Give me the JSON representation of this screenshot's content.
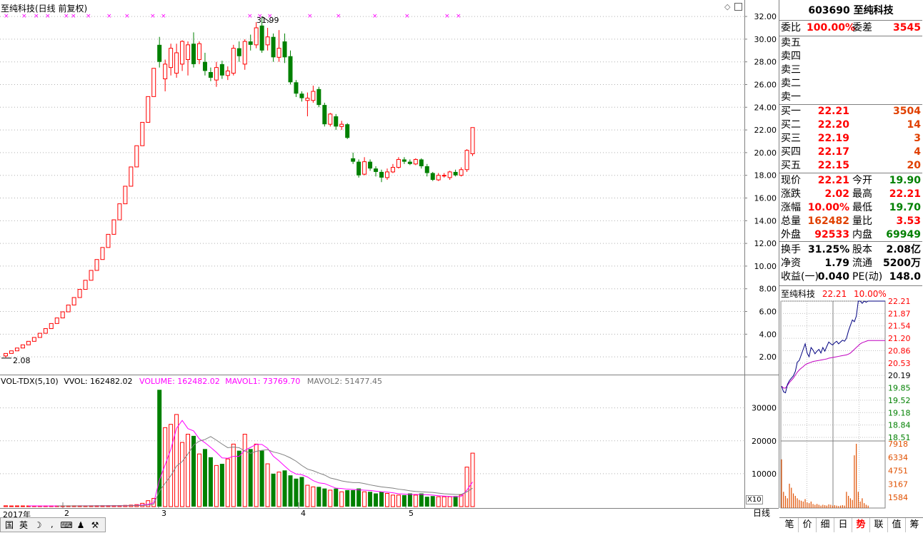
{
  "chart_header": {
    "title": "至纯科技(日线 前复权)",
    "max_label": "31.99",
    "min_label": "2.08",
    "diamond_icon": "diamond-icon",
    "square_icon": "square-icon"
  },
  "volume_header": {
    "name": "VOL-TDX(5,10)",
    "vvol": "VVOL: 162482.02",
    "volume": "VOLUME: 162482.02",
    "mavol1": "MAVOL1: 73769.70",
    "mavol2": "MAVOL2: 51477.45"
  },
  "x_axis": {
    "year": "2017年",
    "months": [
      "2",
      "3",
      "4",
      "5"
    ]
  },
  "price_axis": [
    "32.00",
    "30.00",
    "28.00",
    "26.00",
    "24.00",
    "22.00",
    "20.00",
    "18.00",
    "16.00",
    "14.00",
    "12.00",
    "10.00",
    "8.00",
    "6.00",
    "4.00",
    "2.00"
  ],
  "volume_axis": [
    "30000",
    "20000",
    "10000"
  ],
  "volume_unit": "X10",
  "period": "日线",
  "colors": {
    "up": "#ff0000",
    "down": "#008000",
    "ma1": "#ff00ff",
    "ma2": "#808080",
    "intraday_price": "#000080",
    "intraday_avg": "#c000c0",
    "intraday_vol": "#e05000",
    "value_red": "#ff0000",
    "value_green": "#008000"
  },
  "quote": {
    "code_name": "603690 至纯科技",
    "weibi_label": "委比",
    "weibi": "100.00%",
    "weicha_label": "委差",
    "weicha": "3545",
    "asks": [
      {
        "label": "卖五"
      },
      {
        "label": "卖四"
      },
      {
        "label": "卖三"
      },
      {
        "label": "卖二"
      },
      {
        "label": "卖一"
      }
    ],
    "bids": [
      {
        "label": "买一",
        "price": "22.21",
        "vol": "3504"
      },
      {
        "label": "买二",
        "price": "22.20",
        "vol": "14"
      },
      {
        "label": "买三",
        "price": "22.19",
        "vol": "3"
      },
      {
        "label": "买四",
        "price": "22.17",
        "vol": "4"
      },
      {
        "label": "买五",
        "price": "22.15",
        "vol": "20"
      }
    ],
    "stats": [
      {
        "l1": "现价",
        "v1": "22.21",
        "l2": "今开",
        "v2": "19.90"
      },
      {
        "l1": "涨跌",
        "v1": "2.02",
        "l2": "最高",
        "v2": "22.21"
      },
      {
        "l1": "涨幅",
        "v1": "10.00%",
        "l2": "最低",
        "v2": "19.70"
      },
      {
        "l1": "总量",
        "v1": "162482",
        "l2": "量比",
        "v2": "3.53"
      },
      {
        "l1": "外盘",
        "v1": "92533",
        "l2": "内盘",
        "v2": "69949"
      }
    ],
    "finance": [
      {
        "l1": "换手",
        "v1": "31.25%",
        "l2": "股本",
        "v2": "2.08亿"
      },
      {
        "l1": "净资",
        "v1": "1.79",
        "l2": "流通",
        "v2": "5200万"
      },
      {
        "l1": "收益(一)",
        "v1": "0.040",
        "l2": "PE(动)",
        "v2": "148.0"
      }
    ]
  },
  "intraday": {
    "name": "至纯科技",
    "price": "22.21",
    "pct": "10.00%",
    "price_ticks": [
      "22.21",
      "21.87",
      "21.54",
      "21.20",
      "20.86",
      "20.53",
      "20.19",
      "19.85",
      "19.52",
      "19.18",
      "18.84",
      "18.51"
    ],
    "vol_ticks": [
      "7918",
      "6334",
      "4751",
      "3167",
      "1584"
    ]
  },
  "bottom_tabs": [
    "笔",
    "价",
    "细",
    "日",
    "势",
    "联",
    "值",
    "筹"
  ],
  "active_tab": "势",
  "bottom_icons": [
    {
      "name": "guo-icon",
      "glyph": "国"
    },
    {
      "name": "ying-icon",
      "glyph": "英"
    },
    {
      "name": "moon-icon",
      "glyph": "☽"
    },
    {
      "name": "comma-icon",
      "glyph": "⸴"
    },
    {
      "name": "keyboard-icon",
      "glyph": "⌨"
    },
    {
      "name": "user-icon",
      "glyph": "♟"
    },
    {
      "name": "wrench-icon",
      "glyph": "⚒"
    }
  ],
  "chart_data": {
    "type": "candlestick",
    "title": "至纯科技(日线 前复权)",
    "ylim": [
      0.5,
      33.2
    ],
    "candles": [
      [
        2.08,
        2.3,
        1.95,
        2.3
      ],
      [
        2.3,
        2.53,
        2.3,
        2.53
      ],
      [
        2.53,
        2.78,
        2.53,
        2.78
      ],
      [
        2.78,
        3.06,
        2.78,
        3.06
      ],
      [
        3.06,
        3.37,
        3.06,
        3.37
      ],
      [
        3.37,
        3.71,
        3.37,
        3.71
      ],
      [
        3.71,
        4.08,
        3.71,
        4.08
      ],
      [
        4.08,
        4.49,
        4.08,
        4.49
      ],
      [
        4.49,
        4.94,
        4.49,
        4.94
      ],
      [
        4.94,
        5.43,
        4.94,
        5.43
      ],
      [
        5.43,
        5.97,
        5.43,
        5.97
      ],
      [
        5.97,
        6.57,
        5.97,
        6.57
      ],
      [
        6.57,
        7.23,
        6.57,
        7.23
      ],
      [
        7.23,
        7.95,
        7.23,
        7.95
      ],
      [
        7.95,
        8.75,
        7.95,
        8.75
      ],
      [
        8.75,
        9.62,
        8.75,
        9.62
      ],
      [
        9.62,
        10.58,
        9.62,
        10.58
      ],
      [
        10.58,
        11.64,
        10.58,
        11.64
      ],
      [
        11.64,
        12.8,
        11.64,
        12.8
      ],
      [
        12.8,
        14.08,
        12.8,
        14.08
      ],
      [
        14.08,
        15.49,
        14.08,
        15.49
      ],
      [
        15.49,
        17.04,
        15.49,
        17.04
      ],
      [
        17.04,
        18.74,
        17.04,
        18.74
      ],
      [
        18.74,
        20.61,
        18.74,
        20.61
      ],
      [
        20.61,
        22.67,
        20.61,
        22.67
      ],
      [
        22.67,
        24.94,
        22.67,
        24.94
      ],
      [
        24.94,
        27.43,
        24.94,
        27.43
      ],
      [
        29.5,
        28.0,
        27.5,
        30.2
      ],
      [
        26.5,
        27.8,
        25.4,
        28.2
      ],
      [
        27.5,
        29.2,
        26.8,
        29.6
      ],
      [
        27.0,
        28.8,
        26.6,
        29.6
      ],
      [
        27.8,
        29.8,
        27.2,
        29.9
      ],
      [
        28.2,
        29.5,
        26.8,
        29.8
      ],
      [
        29.6,
        27.8,
        27.5,
        30.6
      ],
      [
        28.2,
        29.6,
        27.8,
        29.8
      ],
      [
        28.0,
        27.2,
        26.8,
        28.8
      ],
      [
        27.1,
        26.6,
        26.3,
        27.5
      ],
      [
        26.4,
        27.5,
        25.8,
        28.0
      ],
      [
        27.8,
        26.8,
        26.5,
        28.1
      ],
      [
        26.8,
        27.2,
        26.4,
        27.6
      ],
      [
        27.0,
        29.2,
        26.8,
        29.5
      ],
      [
        29.2,
        28.5,
        28.0,
        29.8
      ],
      [
        27.8,
        29.8,
        27.3,
        30.0
      ],
      [
        29.8,
        29.5,
        29.0,
        30.4
      ],
      [
        29.5,
        31.0,
        29.2,
        31.5
      ],
      [
        31.2,
        29.0,
        28.8,
        31.99
      ],
      [
        29.5,
        30.2,
        29.0,
        31.0
      ],
      [
        30.2,
        28.4,
        28.0,
        30.5
      ],
      [
        28.4,
        29.2,
        28.0,
        30.8
      ],
      [
        29.8,
        28.4,
        27.9,
        30.5
      ],
      [
        28.5,
        26.2,
        26.0,
        29.0
      ],
      [
        26.2,
        25.2,
        24.9,
        26.4
      ],
      [
        25.2,
        24.8,
        24.5,
        25.4
      ],
      [
        24.6,
        24.8,
        23.2,
        25.3
      ],
      [
        24.6,
        25.4,
        24.4,
        25.9
      ],
      [
        25.6,
        24.2,
        24.0,
        25.8
      ],
      [
        24.2,
        22.5,
        22.3,
        24.4
      ],
      [
        22.5,
        23.4,
        22.3,
        23.5
      ],
      [
        23.2,
        22.3,
        22.0,
        23.4
      ],
      [
        22.3,
        22.5,
        22.0,
        22.8
      ],
      [
        22.5,
        21.3,
        21.2,
        22.6
      ],
      [
        19.5,
        19.2,
        19.0,
        20.0
      ],
      [
        19.2,
        18.0,
        17.8,
        19.4
      ],
      [
        18.1,
        19.2,
        18.0,
        19.6
      ],
      [
        19.2,
        18.6,
        18.4,
        19.4
      ],
      [
        18.6,
        18.3,
        17.9,
        18.8
      ],
      [
        18.3,
        17.8,
        17.4,
        18.5
      ],
      [
        17.8,
        18.3,
        17.6,
        18.6
      ],
      [
        18.3,
        18.7,
        18.2,
        19.0
      ],
      [
        18.7,
        19.4,
        18.6,
        19.6
      ],
      [
        19.4,
        19.2,
        19.0,
        19.6
      ],
      [
        19.2,
        19.0,
        18.9,
        19.4
      ],
      [
        19.0,
        19.4,
        18.9,
        19.5
      ],
      [
        19.4,
        18.8,
        18.6,
        19.5
      ],
      [
        18.8,
        18.2,
        17.9,
        19.0
      ],
      [
        18.2,
        17.6,
        17.5,
        18.3
      ],
      [
        17.6,
        18.0,
        17.5,
        18.2
      ],
      [
        18.0,
        18.0,
        17.8,
        18.2
      ],
      [
        17.8,
        18.3,
        17.6,
        18.4
      ],
      [
        18.3,
        18.0,
        17.9,
        18.5
      ],
      [
        18.0,
        18.5,
        17.9,
        18.7
      ],
      [
        18.5,
        20.2,
        18.3,
        20.3
      ],
      [
        19.9,
        22.21,
        19.7,
        22.21
      ]
    ],
    "volume": [
      250,
      200,
      220,
      210,
      200,
      190,
      180,
      200,
      210,
      220,
      230,
      240,
      250,
      240,
      230,
      250,
      260,
      270,
      280,
      300,
      320,
      380,
      450,
      600,
      1000,
      1800,
      2500,
      35500,
      24000,
      25000,
      28000,
      19500,
      22000,
      21500,
      16000,
      17500,
      15000,
      12500,
      13000,
      14500,
      19000,
      17000,
      22000,
      17500,
      19000,
      17000,
      13000,
      10000,
      10500,
      11000,
      9500,
      8500,
      9000,
      6500,
      6000,
      6000,
      5500,
      5000,
      5500,
      4500,
      5000,
      5000,
      5500,
      4500,
      4500,
      4000,
      4500,
      4000,
      3500,
      3500,
      3500,
      4000,
      3500,
      4000,
      3000,
      3200,
      3000,
      3000,
      3000,
      3200,
      3500,
      12000,
      16248
    ],
    "mavol1": [
      null,
      null,
      null,
      null,
      220,
      210,
      200,
      200,
      200,
      200,
      210,
      220,
      230,
      240,
      240,
      240,
      240,
      250,
      260,
      270,
      280,
      300,
      330,
      380,
      480,
      700,
      1150,
      8100,
      12700,
      17400,
      23800,
      26200,
      23700,
      23000,
      20600,
      19400,
      18000,
      16500,
      14800,
      14700,
      15300,
      15300,
      17100,
      18000,
      18900,
      18900,
      17700,
      15300,
      13900,
      12300,
      10800,
      9900,
      9700,
      9000,
      7900,
      7200,
      7000,
      6300,
      5600,
      5500,
      5300,
      5200,
      5100,
      5000,
      4900,
      4700,
      4500,
      4400,
      4200,
      3900,
      3800,
      3700,
      3700,
      3700,
      3600,
      3500,
      3300,
      3200,
      3100,
      3000,
      3100,
      5000,
      7500
    ],
    "mavol2": [
      null,
      null,
      null,
      null,
      null,
      null,
      null,
      null,
      null,
      215,
      215,
      215,
      215,
      220,
      225,
      230,
      240,
      250,
      255,
      260,
      265,
      275,
      290,
      310,
      360,
      490,
      730,
      4700,
      7100,
      9400,
      12300,
      13700,
      16000,
      18700,
      19900,
      20400,
      21300,
      20200,
      19000,
      17900,
      18100,
      17900,
      16900,
      16200,
      16800,
      17100,
      17300,
      16600,
      16200,
      15600,
      14800,
      13800,
      12500,
      11400,
      10900,
      10200,
      9600,
      8700,
      8300,
      7800,
      7500,
      7300,
      7300,
      7000,
      6600,
      6300,
      6000,
      5800,
      5600,
      5300,
      5100,
      4800,
      4600,
      4500,
      4400,
      4300,
      4100,
      3900,
      3800,
      3700,
      3700,
      4500,
      5600
    ],
    "volume_ylim": [
      0,
      36000
    ],
    "intraday_price": [
      19.9,
      19.75,
      19.72,
      19.95,
      20.05,
      20.12,
      20.18,
      20.3,
      20.55,
      20.6,
      20.75,
      20.9,
      21.05,
      20.8,
      20.7,
      20.95,
      20.88,
      20.78,
      20.85,
      20.9,
      20.8,
      20.95,
      20.85,
      20.98,
      21.1,
      21.05,
      21.02,
      21.08,
      21.12,
      21.05,
      21.1,
      21.15,
      21.12,
      21.2,
      21.4,
      21.55,
      21.7,
      21.65,
      21.8,
      22.21,
      22.21,
      22.15,
      22.21,
      22.18,
      22.21
    ],
    "intraday_avg": [
      19.9,
      19.85,
      19.85,
      19.92,
      20.0,
      20.06,
      20.12,
      20.2,
      20.28,
      20.34,
      20.39,
      20.43,
      20.48,
      20.51,
      20.53,
      20.55,
      20.57,
      20.58,
      20.59,
      20.6,
      20.61,
      20.62,
      20.63,
      20.64,
      20.66,
      20.67,
      20.68,
      20.69,
      20.7,
      20.71,
      20.72,
      20.73,
      20.74,
      20.75,
      20.77,
      20.8,
      20.85,
      20.9,
      20.95,
      21.0,
      21.05,
      21.08,
      21.1,
      21.12,
      21.14
    ],
    "intraday_volume": [
      6000,
      2000,
      1500,
      1200,
      3000,
      2500,
      1800,
      1500,
      1200,
      1000,
      900,
      800,
      1100,
      700,
      600,
      800,
      500,
      400,
      500,
      400,
      300,
      400,
      350,
      300,
      450,
      400,
      300,
      350,
      300,
      250,
      300,
      350,
      300,
      2000,
      1500,
      1200,
      1000,
      6500,
      7918,
      2000,
      800,
      1200,
      600,
      400,
      300
    ],
    "intraday_ylim": [
      18.51,
      22.21
    ],
    "intraday_vol_ylim": [
      0,
      7918
    ]
  }
}
